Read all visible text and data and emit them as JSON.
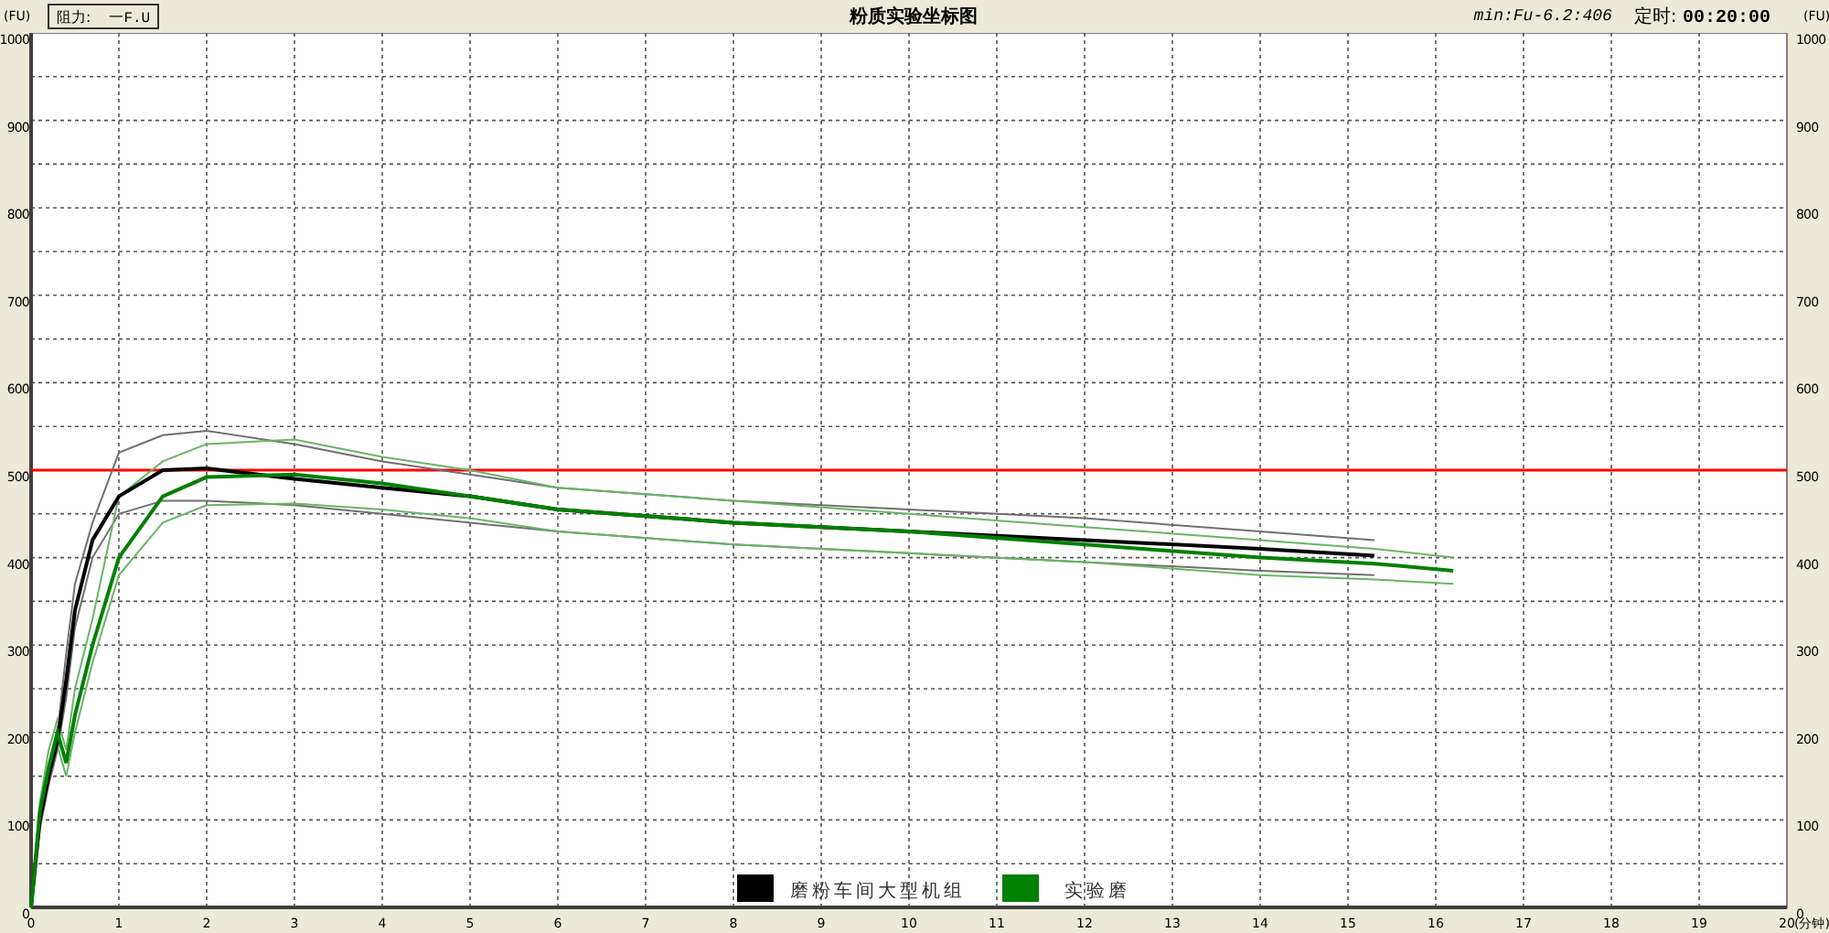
{
  "resistance": {
    "label": "阻力:",
    "value": "一F.U"
  },
  "min_reading": "min:Fu-6.2:406",
  "timer": {
    "label": "定时:",
    "value": "00:20:00"
  },
  "right_axis": {
    "unit": "(FU)",
    "ticks": [
      "1000",
      "900",
      "800",
      "700",
      "600",
      "500",
      "400",
      "300",
      "200",
      "100",
      "0"
    ]
  },
  "chart_data": {
    "type": "line",
    "title": "粉质实验坐标图",
    "xlabel": "(分钟)",
    "ylabel": "(FU)",
    "grid": true,
    "legend": "lower center",
    "xlim": [
      0,
      20
    ],
    "ylim": [
      0,
      1000
    ],
    "xticks": [
      0,
      1,
      2,
      3,
      4,
      5,
      6,
      7,
      8,
      9,
      10,
      11,
      12,
      13,
      14,
      15,
      16,
      17,
      18,
      19,
      20
    ],
    "yticks": [
      0,
      100,
      200,
      300,
      400,
      500,
      600,
      700,
      800,
      900,
      1000
    ],
    "x": [
      0,
      0.1,
      0.2,
      0.3,
      0.4,
      0.5,
      0.7,
      1,
      1.5,
      2,
      3,
      4,
      5,
      6,
      8,
      10,
      12,
      14,
      15.3,
      16.2
    ],
    "series": [
      {
        "color": "#707070",
        "values": [
          0,
          110,
          160,
          200,
          290,
          370,
          440,
          520,
          540,
          545,
          530,
          510,
          495,
          480,
          465,
          455,
          445,
          430,
          420,
          null
        ]
      },
      {
        "color": "#707070",
        "values": [
          0,
          90,
          140,
          180,
          240,
          320,
          400,
          450,
          465,
          465,
          460,
          450,
          440,
          430,
          415,
          405,
          395,
          385,
          380,
          null
        ]
      },
      {
        "color": "#6ab46a",
        "values": [
          0,
          120,
          180,
          215,
          180,
          250,
          330,
          470,
          510,
          530,
          535,
          515,
          500,
          480,
          465,
          450,
          435,
          420,
          410,
          400
        ]
      },
      {
        "color": "#6ab46a",
        "values": [
          0,
          100,
          150,
          185,
          150,
          200,
          280,
          380,
          440,
          460,
          462,
          455,
          445,
          430,
          415,
          405,
          395,
          380,
          375,
          370
        ]
      },
      {
        "name": "磨粉车间大型机组",
        "color": "#000000",
        "values": [
          0,
          100,
          150,
          190,
          260,
          340,
          420,
          470,
          500,
          502,
          490,
          480,
          470,
          455,
          440,
          430,
          420,
          410,
          402,
          null
        ]
      },
      {
        "name": "实验磨",
        "color": "#008000",
        "values": [
          0,
          110,
          160,
          200,
          165,
          220,
          300,
          400,
          470,
          492,
          495,
          485,
          470,
          455,
          440,
          430,
          415,
          400,
          393,
          385
        ]
      }
    ],
    "ref_lines": [
      {
        "axis": "y",
        "value": 500,
        "color": "#ff0000"
      }
    ]
  }
}
